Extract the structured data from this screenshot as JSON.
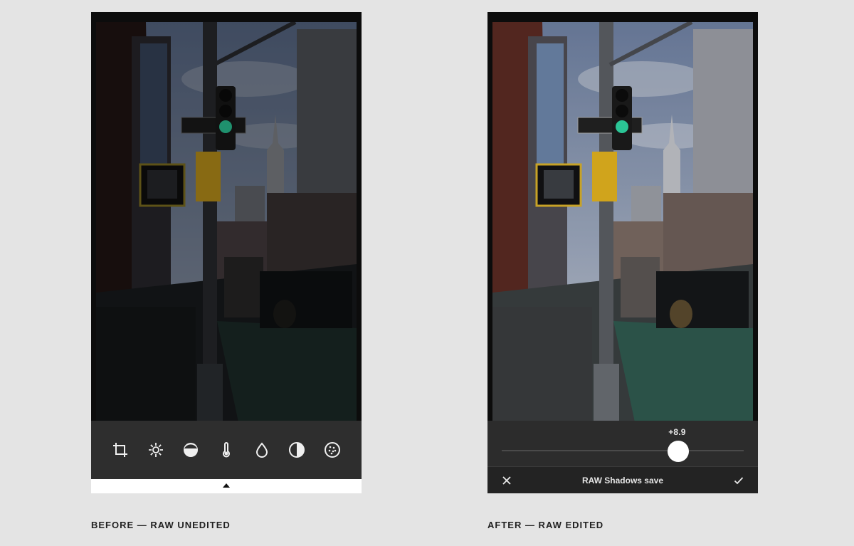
{
  "before": {
    "caption": "BEFORE — RAW UNEDITED",
    "tools": [
      {
        "icon": "crop-icon"
      },
      {
        "icon": "exposure-sun-icon"
      },
      {
        "icon": "shadows-half-circle-icon"
      },
      {
        "icon": "temperature-thermometer-icon"
      },
      {
        "icon": "saturation-drop-icon"
      },
      {
        "icon": "contrast-icon"
      },
      {
        "icon": "grain-icon"
      }
    ]
  },
  "after": {
    "caption": "AFTER — RAW EDITED",
    "slider": {
      "value_label": "+8.9",
      "position_fraction": 0.73
    },
    "tool_name": "RAW Shadows save",
    "cancel_icon": "close-icon",
    "confirm_icon": "checkmark-icon"
  },
  "colors": {
    "background": "#e4e4e4",
    "phone_frame": "#0c0c0c",
    "toolbar": "#2e2e2e",
    "signal_green": "#2fd6a3",
    "signal_yellow": "#e2b21f"
  }
}
